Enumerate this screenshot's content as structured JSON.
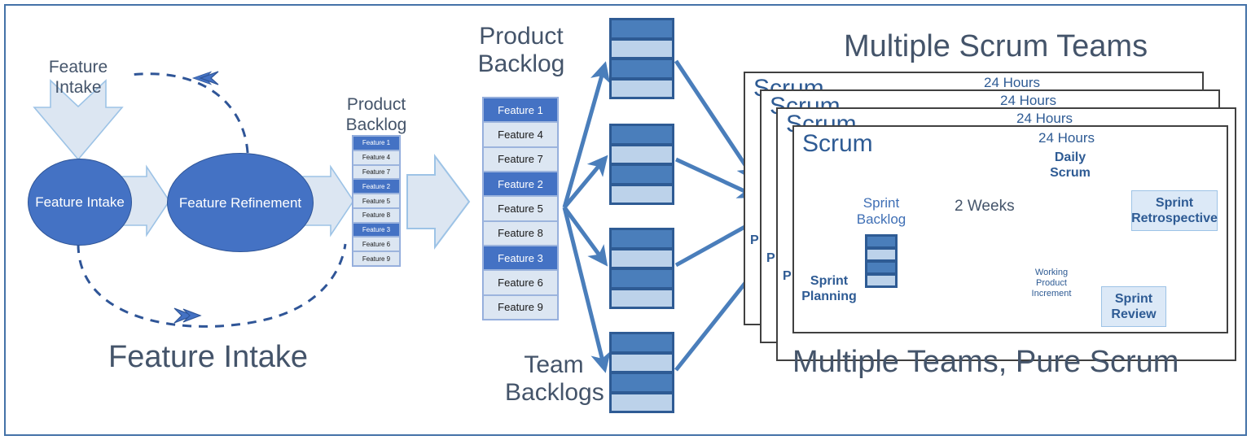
{
  "diagram": {
    "title_left": "Feature Intake",
    "title_center_top": "Product Backlog",
    "title_center_bottom": "Team Backlogs",
    "title_right_top": "Multiple Scrum Teams",
    "title_right_bottom": "Multiple Teams, Pure Scrum"
  },
  "colors": {
    "accent_blue": "#4472c4",
    "dark_blue": "#2e5b94",
    "light_blue": "#dce6f2",
    "mid_blue": "#b4c7e7",
    "grey_text": "#44546a",
    "green_cube": "#c5e0a5",
    "frame": "#4472a8"
  },
  "left_flow": {
    "intake_arrow_label": "Feature Intake",
    "ellipse_1": "Feature Intake",
    "ellipse_2": "Feature Refinement",
    "mini_backlog_title": "Product Backlog",
    "mini_backlog_items": [
      {
        "label": "Feature 1",
        "tone": "dark"
      },
      {
        "label": "Feature 4",
        "tone": "light"
      },
      {
        "label": "Feature 7",
        "tone": "light"
      },
      {
        "label": "Feature 2",
        "tone": "dark"
      },
      {
        "label": "Feature 5",
        "tone": "light"
      },
      {
        "label": "Feature 8",
        "tone": "light"
      },
      {
        "label": "Feature 3",
        "tone": "dark"
      },
      {
        "label": "Feature 6",
        "tone": "light"
      },
      {
        "label": "Feature 9",
        "tone": "light"
      }
    ]
  },
  "product_backlog": {
    "title_line1": "Product",
    "title_line2": "Backlog",
    "items": [
      {
        "label": "Feature 1",
        "tone": "dark"
      },
      {
        "label": "Feature 4",
        "tone": "light"
      },
      {
        "label": "Feature 7",
        "tone": "light"
      },
      {
        "label": "Feature 2",
        "tone": "dark"
      },
      {
        "label": "Feature 5",
        "tone": "light"
      },
      {
        "label": "Feature 8",
        "tone": "light"
      },
      {
        "label": "Feature 3",
        "tone": "dark"
      },
      {
        "label": "Feature 6",
        "tone": "light"
      },
      {
        "label": "Feature 9",
        "tone": "light"
      }
    ]
  },
  "team_backlogs": {
    "title_line1": "Team",
    "title_line2": "Backlogs",
    "stacks": [
      {
        "rows": [
          "dark",
          "light",
          "dark",
          "light"
        ]
      },
      {
        "rows": [
          "dark",
          "light",
          "dark",
          "light"
        ]
      },
      {
        "rows": [
          "dark",
          "light",
          "dark",
          "light"
        ]
      },
      {
        "rows": [
          "dark",
          "light",
          "dark",
          "light"
        ]
      }
    ]
  },
  "scrum": {
    "heading_top": "Multiple Scrum Teams",
    "heading_bottom": "Multiple Teams, Pure Scrum",
    "panel_label": "Scrum",
    "panels": [
      {
        "label": "Scrum",
        "hours": "24 Hours",
        "planning_abbrev": "P"
      },
      {
        "label": "Scrum",
        "hours": "24 Hours",
        "planning_abbrev": "P"
      },
      {
        "label": "Scrum",
        "hours": "24 Hours",
        "planning_abbrev": "P"
      },
      {
        "label": "Scrum",
        "hours": "24 Hours",
        "planning_abbrev": ""
      }
    ],
    "front": {
      "label": "Scrum",
      "hours": "24 Hours",
      "daily_scrum_line1": "Daily",
      "daily_scrum_line2": "Scrum",
      "sprint_cycle": "2 Weeks",
      "sprint_backlog_line1": "Sprint",
      "sprint_backlog_line2": "Backlog",
      "sprint_planning_line1": "Sprint",
      "sprint_planning_line2": "Planning",
      "working_increment_line1": "Working",
      "working_increment_line2": "Product",
      "working_increment_line3": "Increment",
      "sprint_retrospective_line1": "Sprint",
      "sprint_retrospective_line2": "Retrospective",
      "sprint_review_line1": "Sprint",
      "sprint_review_line2": "Review",
      "sprint_backlog_rows": [
        "dark",
        "light",
        "dark",
        "light"
      ]
    }
  }
}
